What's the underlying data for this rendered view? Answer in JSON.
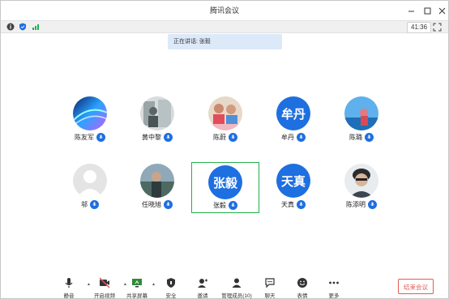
{
  "window": {
    "title": "腾讯会议"
  },
  "infobar": {
    "timer": "41:36"
  },
  "speaking_banner": "正在讲话: 张毅",
  "participants": [
    {
      "name": "陈友军",
      "avatar_text": ""
    },
    {
      "name": "黄中黎",
      "avatar_text": ""
    },
    {
      "name": "陈蔚",
      "avatar_text": ""
    },
    {
      "name": "牟丹",
      "avatar_text": "牟丹"
    },
    {
      "name": "陈璐",
      "avatar_text": ""
    },
    {
      "name": "邬",
      "avatar_text": ""
    },
    {
      "name": "任晓旭",
      "avatar_text": ""
    },
    {
      "name": "张毅",
      "avatar_text": "张毅"
    },
    {
      "name": "天真",
      "avatar_text": "天真"
    },
    {
      "name": "陈添明",
      "avatar_text": ""
    }
  ],
  "toolbar": {
    "mute": "静音",
    "video": "开启视频",
    "share": "共享屏幕",
    "security": "安全",
    "invite": "邀请",
    "members": "管理成员(10)",
    "chat": "聊天",
    "emoji": "表情",
    "more": "更多",
    "end": "结束会议"
  },
  "colors": {
    "accent": "#1e6fe0",
    "active_border": "#22b14c",
    "end": "#e25a5a"
  }
}
